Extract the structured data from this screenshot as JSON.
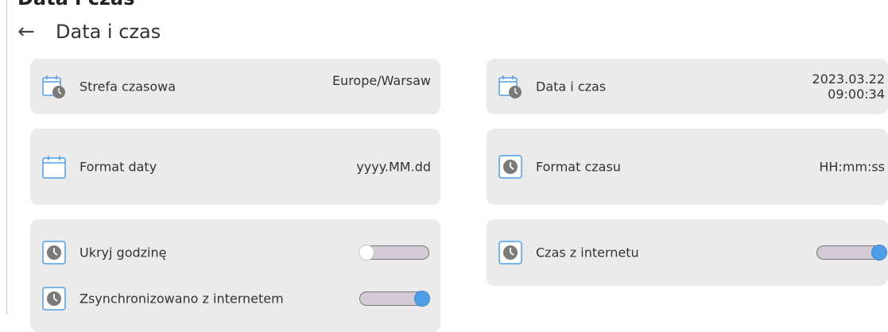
{
  "page": {
    "cut_title": "Data i czas",
    "title": "Data i czas"
  },
  "settings": [
    {
      "label": "Strefa czasowa",
      "value": "Europe/Warsaw",
      "icon": "calendar-clock-icon"
    },
    {
      "label": "Data i czas",
      "value": "2023.03.22\n09:00:34",
      "icon": "calendar-clock-icon"
    },
    {
      "label": "Format daty",
      "value": "yyyy.MM.dd",
      "icon": "calendar-icon"
    },
    {
      "label": "Format czasu",
      "value": "HH:mm:ss",
      "icon": "clock-icon"
    },
    {
      "label": "Ukryj godzinę",
      "toggle_on": false,
      "icon": "clock-icon"
    },
    {
      "label": "Czas z internetu",
      "toggle_on": true,
      "icon": "clock-icon"
    },
    {
      "label": "Zsynchronizowano z internetem",
      "toggle_on": true,
      "icon": "clock-icon"
    }
  ],
  "colors": {
    "tile_bg": "#ebebeb",
    "icon_blue": "#4f9fe8",
    "toggle_track": "#d3cbd5",
    "toggle_on_knob": "#4f9fe8"
  }
}
